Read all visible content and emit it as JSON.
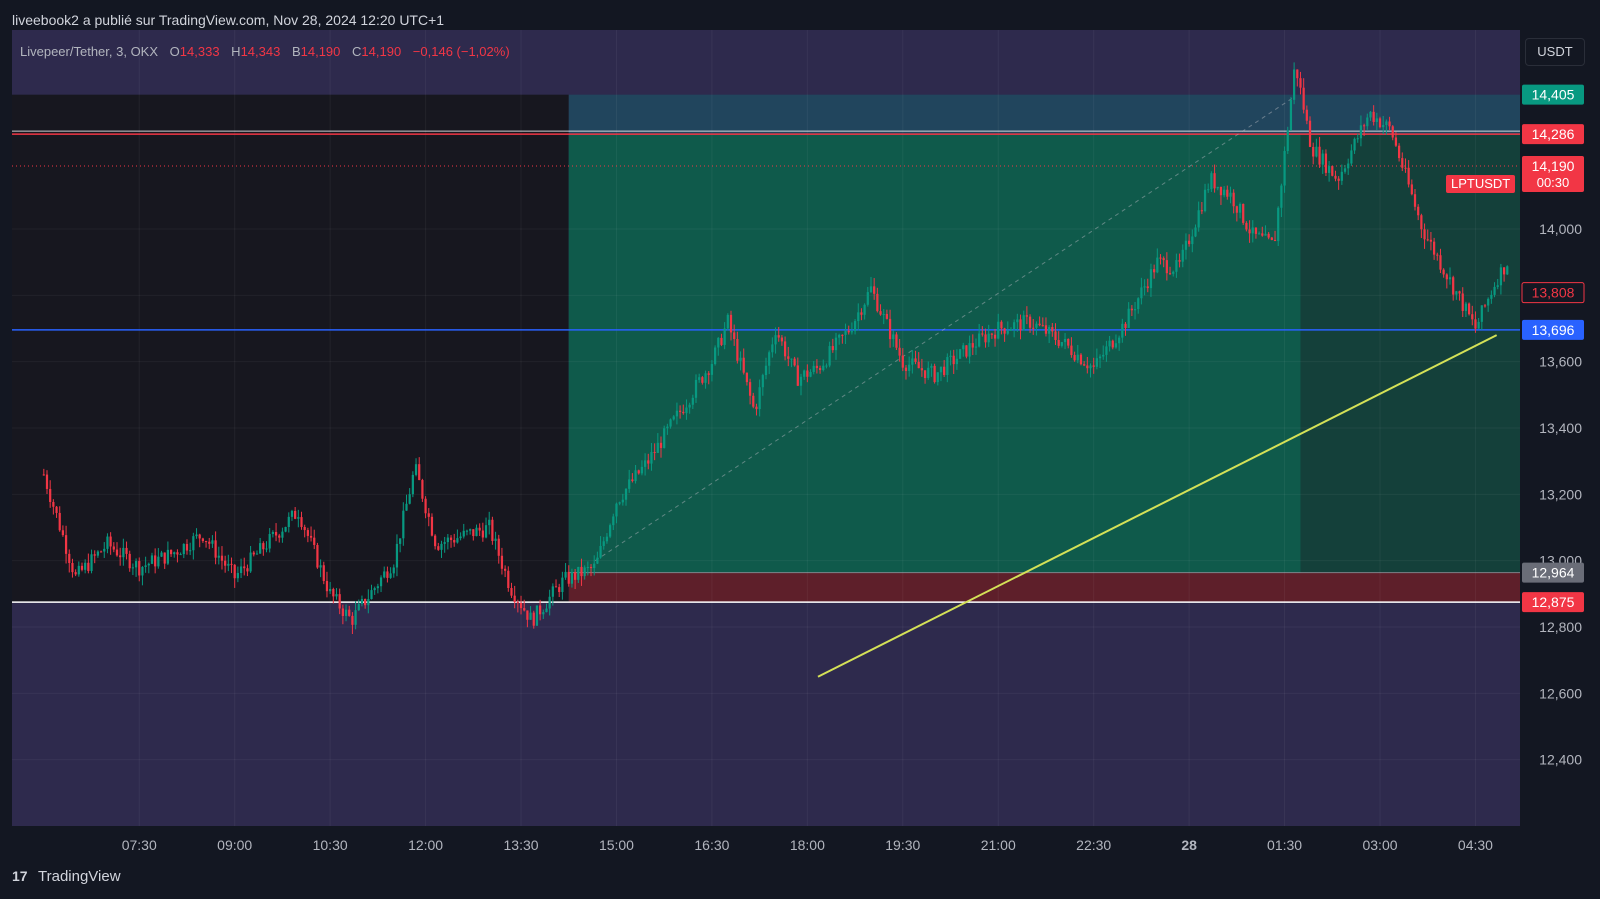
{
  "header": {
    "attribution": "liveebook2 a publié sur TradingView.com, Nov 28, 2024 12:20 UTC+1"
  },
  "legend": {
    "symbol": "Livepeer/Tether, 3, OKX",
    "open_label": "O",
    "open": "14,333",
    "high_label": "H",
    "high": "14,343",
    "low_label": "B",
    "low": "14,190",
    "close_label": "C",
    "close": "14,190",
    "change": "−0,146 (−1,02%)"
  },
  "currency_button": "USDT",
  "symbol_tag": "LPTUSDT",
  "footer": {
    "logo": "17",
    "brand": "TradingView"
  },
  "colors": {
    "up": "#089981",
    "down": "#f23645",
    "blue_line": "#2962ff",
    "trend_line": "#d4e157",
    "profit_zone": "#0f5c4a",
    "loss_zone": "#5e1f2a",
    "outer_zone": "#2e2a4d"
  },
  "chart_data": {
    "type": "candlestick",
    "title": "Livepeer/Tether, 3, OKX",
    "x_ticks": [
      "07:30",
      "09:00",
      "10:30",
      "12:00",
      "13:30",
      "15:00",
      "16:30",
      "18:00",
      "19:30",
      "21:00",
      "22:30",
      "28",
      "01:30",
      "03:00",
      "04:30"
    ],
    "y_ticks": [
      "12,400",
      "12,600",
      "12,800",
      "13,000",
      "13,200",
      "13,400",
      "13,600",
      "13,800",
      "14,000"
    ],
    "ylim": [
      12.2,
      14.6
    ],
    "price_labels": [
      {
        "value": "14,405",
        "kind": "target"
      },
      {
        "value": "14,286",
        "kind": "line"
      },
      {
        "value": "14,190",
        "sub": "00:30",
        "kind": "last"
      },
      {
        "value": "13,808",
        "kind": "outline"
      },
      {
        "value": "13,696",
        "kind": "blue"
      },
      {
        "value": "12,964",
        "kind": "entry"
      },
      {
        "value": "12,875",
        "kind": "stop"
      }
    ],
    "horizontal_lines": [
      {
        "price": 14.286,
        "color": "#f23645"
      },
      {
        "price": 14.19,
        "color": "#f23645",
        "style": "dotted"
      },
      {
        "price": 13.696,
        "color": "#2962ff"
      },
      {
        "price": 12.875,
        "color": "#ffffff"
      }
    ],
    "position": {
      "type": "long",
      "entry": 12.964,
      "target": 14.405,
      "stop": 12.875,
      "start_time": "14:15",
      "close_time": "01:45"
    },
    "trend_line": {
      "start": [
        "18:10",
        12.65
      ],
      "end": [
        "04:50",
        13.68
      ]
    },
    "price_path": [
      [
        "06:00",
        13.26
      ],
      [
        "06:30",
        12.95
      ],
      [
        "07:00",
        13.05
      ],
      [
        "07:30",
        12.98
      ],
      [
        "08:00",
        13.02
      ],
      [
        "08:30",
        13.08
      ],
      [
        "09:00",
        12.95
      ],
      [
        "09:30",
        13.05
      ],
      [
        "10:00",
        13.15
      ],
      [
        "10:30",
        12.9
      ],
      [
        "10:50",
        12.82
      ],
      [
        "11:30",
        13.0
      ],
      [
        "11:50",
        13.28
      ],
      [
        "12:10",
        13.05
      ],
      [
        "12:40",
        13.08
      ],
      [
        "13:00",
        13.1
      ],
      [
        "13:20",
        12.92
      ],
      [
        "13:40",
        12.82
      ],
      [
        "14:10",
        12.94
      ],
      [
        "14:40",
        12.98
      ],
      [
        "15:00",
        13.18
      ],
      [
        "15:30",
        13.3
      ],
      [
        "16:00",
        13.45
      ],
      [
        "16:30",
        13.6
      ],
      [
        "16:45",
        13.72
      ],
      [
        "17:10",
        13.45
      ],
      [
        "17:30",
        13.7
      ],
      [
        "17:50",
        13.55
      ],
      [
        "18:10",
        13.58
      ],
      [
        "18:40",
        13.7
      ],
      [
        "19:00",
        13.82
      ],
      [
        "19:30",
        13.6
      ],
      [
        "20:00",
        13.56
      ],
      [
        "20:40",
        13.66
      ],
      [
        "21:00",
        13.7
      ],
      [
        "21:30",
        13.72
      ],
      [
        "22:00",
        13.66
      ],
      [
        "22:30",
        13.58
      ],
      [
        "23:00",
        13.72
      ],
      [
        "23:30",
        13.9
      ],
      [
        "23:50",
        13.88
      ],
      [
        "00:20",
        14.15
      ],
      [
        "00:40",
        14.1
      ],
      [
        "01:00",
        13.98
      ],
      [
        "01:20",
        13.95
      ],
      [
        "01:40",
        14.5
      ],
      [
        "01:55",
        14.25
      ],
      [
        "02:20",
        14.15
      ],
      [
        "02:50",
        14.35
      ],
      [
        "03:10",
        14.3
      ],
      [
        "03:40",
        14.0
      ],
      [
        "04:00",
        13.88
      ],
      [
        "04:30",
        13.7
      ],
      [
        "04:50",
        13.85
      ],
      [
        "05:00",
        13.9
      ]
    ]
  }
}
